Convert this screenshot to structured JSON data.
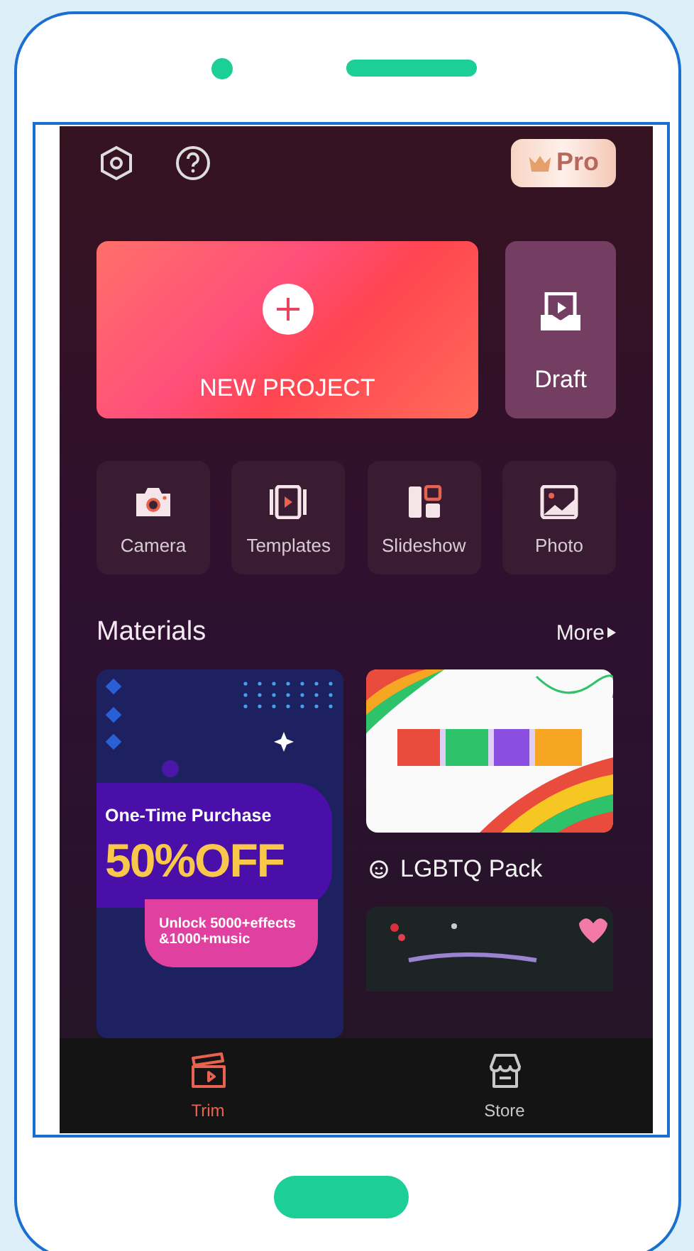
{
  "top_bar": {
    "pro_label": "Pro"
  },
  "new_project": {
    "label": "NEW PROJECT"
  },
  "draft": {
    "label": "Draft"
  },
  "tools": [
    {
      "kind": "camera",
      "label": "Camera"
    },
    {
      "kind": "templates",
      "label": "Templates"
    },
    {
      "kind": "slideshow",
      "label": "Slideshow"
    },
    {
      "label": "Photo"
    }
  ],
  "materials": {
    "title": "Materials",
    "more": "More"
  },
  "promo": {
    "line1": "One-Time Purchase",
    "headline": "50%OFF",
    "unlock": [
      "Unlock 5000+effects",
      "&1000+music"
    ]
  },
  "pack": {
    "label": "LGBTQ Pack"
  },
  "nav": [
    {
      "kind": "trim",
      "label": "Trim",
      "selected": true
    },
    {
      "kind": "store",
      "label": "Store",
      "selected": false
    }
  ]
}
